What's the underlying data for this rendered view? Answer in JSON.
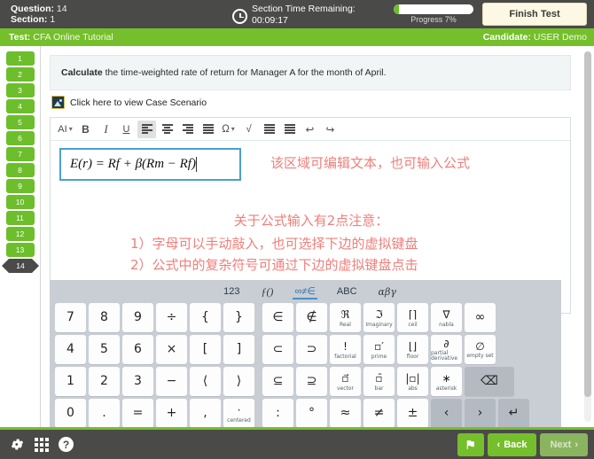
{
  "header": {
    "question_label": "Question:",
    "question_value": "14",
    "section_label": "Section:",
    "section_value": "1",
    "timer_label": "Section Time Remaining:",
    "timer_value": "00:09:17",
    "progress_text": "Progress 7%",
    "progress_percent": 7,
    "finish_button": "Finish Test",
    "clock_icon": "clock-icon"
  },
  "testbar": {
    "test_label": "Test:",
    "test_value": "CFA Online Tutorial",
    "candidate_label": "Candidate:",
    "candidate_value": "USER Demo"
  },
  "sidebar": {
    "items": [
      {
        "label": "1",
        "state": "answered"
      },
      {
        "label": "2",
        "state": "answered"
      },
      {
        "label": "3",
        "state": "answered"
      },
      {
        "label": "4",
        "state": "answered"
      },
      {
        "label": "5",
        "state": "answered"
      },
      {
        "label": "6",
        "state": "answered"
      },
      {
        "label": "7",
        "state": "answered"
      },
      {
        "label": "8",
        "state": "answered"
      },
      {
        "label": "9",
        "state": "answered"
      },
      {
        "label": "10",
        "state": "answered"
      },
      {
        "label": "11",
        "state": "answered"
      },
      {
        "label": "12",
        "state": "answered"
      },
      {
        "label": "13",
        "state": "answered"
      },
      {
        "label": "14",
        "state": "current"
      }
    ]
  },
  "question": {
    "prompt_bold": "Calculate",
    "prompt_rest": " the time-weighted rate of return for Manager A for the month of April.",
    "case_link": "Click here to view Case Scenario",
    "case_icon": "image-icon"
  },
  "editor": {
    "toolbar": [
      {
        "name": "ai-menu",
        "label": "AI",
        "caret": true,
        "active": false
      },
      {
        "name": "bold-button",
        "label": "B",
        "active": false
      },
      {
        "name": "italic-button",
        "label": "I",
        "active": false
      },
      {
        "name": "underline-button",
        "label": "U",
        "active": false
      },
      {
        "name": "align-left-button",
        "label": "",
        "active": true
      },
      {
        "name": "align-center-button",
        "label": "",
        "active": false
      },
      {
        "name": "align-right-button",
        "label": "",
        "active": false
      },
      {
        "name": "align-justify-button",
        "label": "",
        "active": false
      },
      {
        "name": "symbol-menu",
        "label": "Ω",
        "caret": true,
        "active": false
      },
      {
        "name": "sqrt-button",
        "label": "√",
        "active": false
      },
      {
        "name": "indent-button",
        "label": "",
        "active": false
      },
      {
        "name": "outdent-button",
        "label": "",
        "active": false
      },
      {
        "name": "undo-button",
        "label": "↩",
        "active": false
      },
      {
        "name": "redo-button",
        "label": "↪",
        "active": false
      }
    ],
    "formula_value": "E(r) = Rf + β(Rm − Rf)",
    "annotation_1": "该区域可编辑文本，也可输入公式",
    "annotation_2": "关于公式输入有2点注意：",
    "annotation_3": "1）字母可以手动敲入，也可选择下边的虚拟键盘",
    "annotation_4": "2）公式中的复杂符号可通过下边的虚拟键盘点击"
  },
  "keyboard": {
    "tabs": [
      {
        "label": "123",
        "name": "tab-numbers",
        "active": false,
        "style": "num"
      },
      {
        "label": "ƒ()",
        "name": "tab-functions",
        "active": false,
        "style": "fn"
      },
      {
        "label": "∞≠∈",
        "name": "tab-symbols",
        "active": true,
        "style": "num"
      },
      {
        "label": "ABC",
        "name": "tab-abc",
        "active": false,
        "style": "num"
      },
      {
        "label": "αβγ",
        "name": "tab-greek",
        "active": false,
        "style": "greek"
      }
    ],
    "rows": [
      [
        {
          "glyph": "7",
          "sub": "",
          "name": "key-7"
        },
        {
          "glyph": "8",
          "sub": "",
          "name": "key-8"
        },
        {
          "glyph": "9",
          "sub": "",
          "name": "key-9"
        },
        {
          "glyph": "÷",
          "sub": "",
          "name": "key-divide"
        },
        {
          "glyph": "{",
          "sub": "",
          "name": "key-brace-open"
        },
        {
          "glyph": "}",
          "sub": "",
          "name": "key-brace-close"
        },
        {
          "glyph": "∈",
          "sub": "",
          "name": "key-element-of"
        },
        {
          "glyph": "∉",
          "sub": "",
          "name": "key-not-element-of"
        },
        {
          "glyph": "ℜ",
          "sub": "Real",
          "name": "key-real"
        },
        {
          "glyph": "ℑ",
          "sub": "Imaginary",
          "name": "key-imaginary"
        },
        {
          "glyph": "⌈⌉",
          "sub": "ceil",
          "name": "key-ceil"
        },
        {
          "glyph": "∇",
          "sub": "nabla",
          "name": "key-nabla"
        },
        {
          "glyph": "∞",
          "sub": "",
          "name": "key-infinity"
        }
      ],
      [
        {
          "glyph": "4",
          "sub": "",
          "name": "key-4"
        },
        {
          "glyph": "5",
          "sub": "",
          "name": "key-5"
        },
        {
          "glyph": "6",
          "sub": "",
          "name": "key-6"
        },
        {
          "glyph": "×",
          "sub": "",
          "name": "key-multiply"
        },
        {
          "glyph": "[",
          "sub": "",
          "name": "key-bracket-open"
        },
        {
          "glyph": "]",
          "sub": "",
          "name": "key-bracket-close"
        },
        {
          "glyph": "⊂",
          "sub": "",
          "name": "key-subset"
        },
        {
          "glyph": "⊃",
          "sub": "",
          "name": "key-superset"
        },
        {
          "glyph": "!",
          "sub": "factorial",
          "name": "key-factorial"
        },
        {
          "glyph": "▫′",
          "sub": "prime",
          "name": "key-prime"
        },
        {
          "glyph": "⌊⌋",
          "sub": "floor",
          "name": "key-floor"
        },
        {
          "glyph": "∂",
          "sub": "partial derivative",
          "name": "key-partial-derivative"
        },
        {
          "glyph": "∅",
          "sub": "empty set",
          "name": "key-empty-set"
        }
      ],
      [
        {
          "glyph": "1",
          "sub": "",
          "name": "key-1"
        },
        {
          "glyph": "2",
          "sub": "",
          "name": "key-2"
        },
        {
          "glyph": "3",
          "sub": "",
          "name": "key-3"
        },
        {
          "glyph": "−",
          "sub": "",
          "name": "key-minus"
        },
        {
          "glyph": "⟨",
          "sub": "",
          "name": "key-angle-open"
        },
        {
          "glyph": "⟩",
          "sub": "",
          "name": "key-angle-close"
        },
        {
          "glyph": "⊆",
          "sub": "",
          "name": "key-subset-equal"
        },
        {
          "glyph": "⊇",
          "sub": "",
          "name": "key-superset-equal"
        },
        {
          "glyph": "▫⃗",
          "sub": "vector",
          "name": "key-vector"
        },
        {
          "glyph": "▫̄",
          "sub": "bar",
          "name": "key-bar"
        },
        {
          "glyph": "|▫|",
          "sub": "abs",
          "name": "key-abs"
        },
        {
          "glyph": "∗",
          "sub": "asterisk",
          "name": "key-asterisk"
        },
        {
          "glyph": "⌫",
          "sub": "",
          "name": "key-backspace",
          "gray": true
        }
      ],
      [
        {
          "glyph": "0",
          "sub": "",
          "name": "key-0"
        },
        {
          "glyph": ".",
          "sub": "",
          "name": "key-period"
        },
        {
          "glyph": "=",
          "sub": "",
          "name": "key-equals"
        },
        {
          "glyph": "+",
          "sub": "",
          "name": "key-plus"
        },
        {
          "glyph": ",",
          "sub": "",
          "name": "key-comma"
        },
        {
          "glyph": "·",
          "sub": "centered",
          "name": "key-centered-dot"
        },
        {
          "glyph": ":",
          "sub": "",
          "name": "key-colon"
        },
        {
          "glyph": "°",
          "sub": "",
          "name": "key-degree"
        },
        {
          "glyph": "≈",
          "sub": "",
          "name": "key-approx"
        },
        {
          "glyph": "≠",
          "sub": "",
          "name": "key-not-equal"
        },
        {
          "glyph": "±",
          "sub": "",
          "name": "key-plus-minus"
        },
        {
          "glyph": "‹",
          "sub": "",
          "name": "key-left-arrow",
          "gray": true
        },
        {
          "glyph": "›",
          "sub": "",
          "name": "key-right-arrow",
          "gray": true
        },
        {
          "glyph": "↵",
          "sub": "",
          "name": "key-enter",
          "gray": true
        }
      ]
    ]
  },
  "footer": {
    "settings_icon": "gear-icon",
    "grid_icon": "grid-icon",
    "help_icon": "help-icon",
    "flag_icon": "flag-icon",
    "back_label": "Back",
    "next_label": "Next"
  },
  "colors": {
    "brand_green": "#74bf2b",
    "dark_gray": "#4a4a48",
    "annotation_red": "#ef7f7a",
    "editor_blue": "#4a9fd4"
  }
}
